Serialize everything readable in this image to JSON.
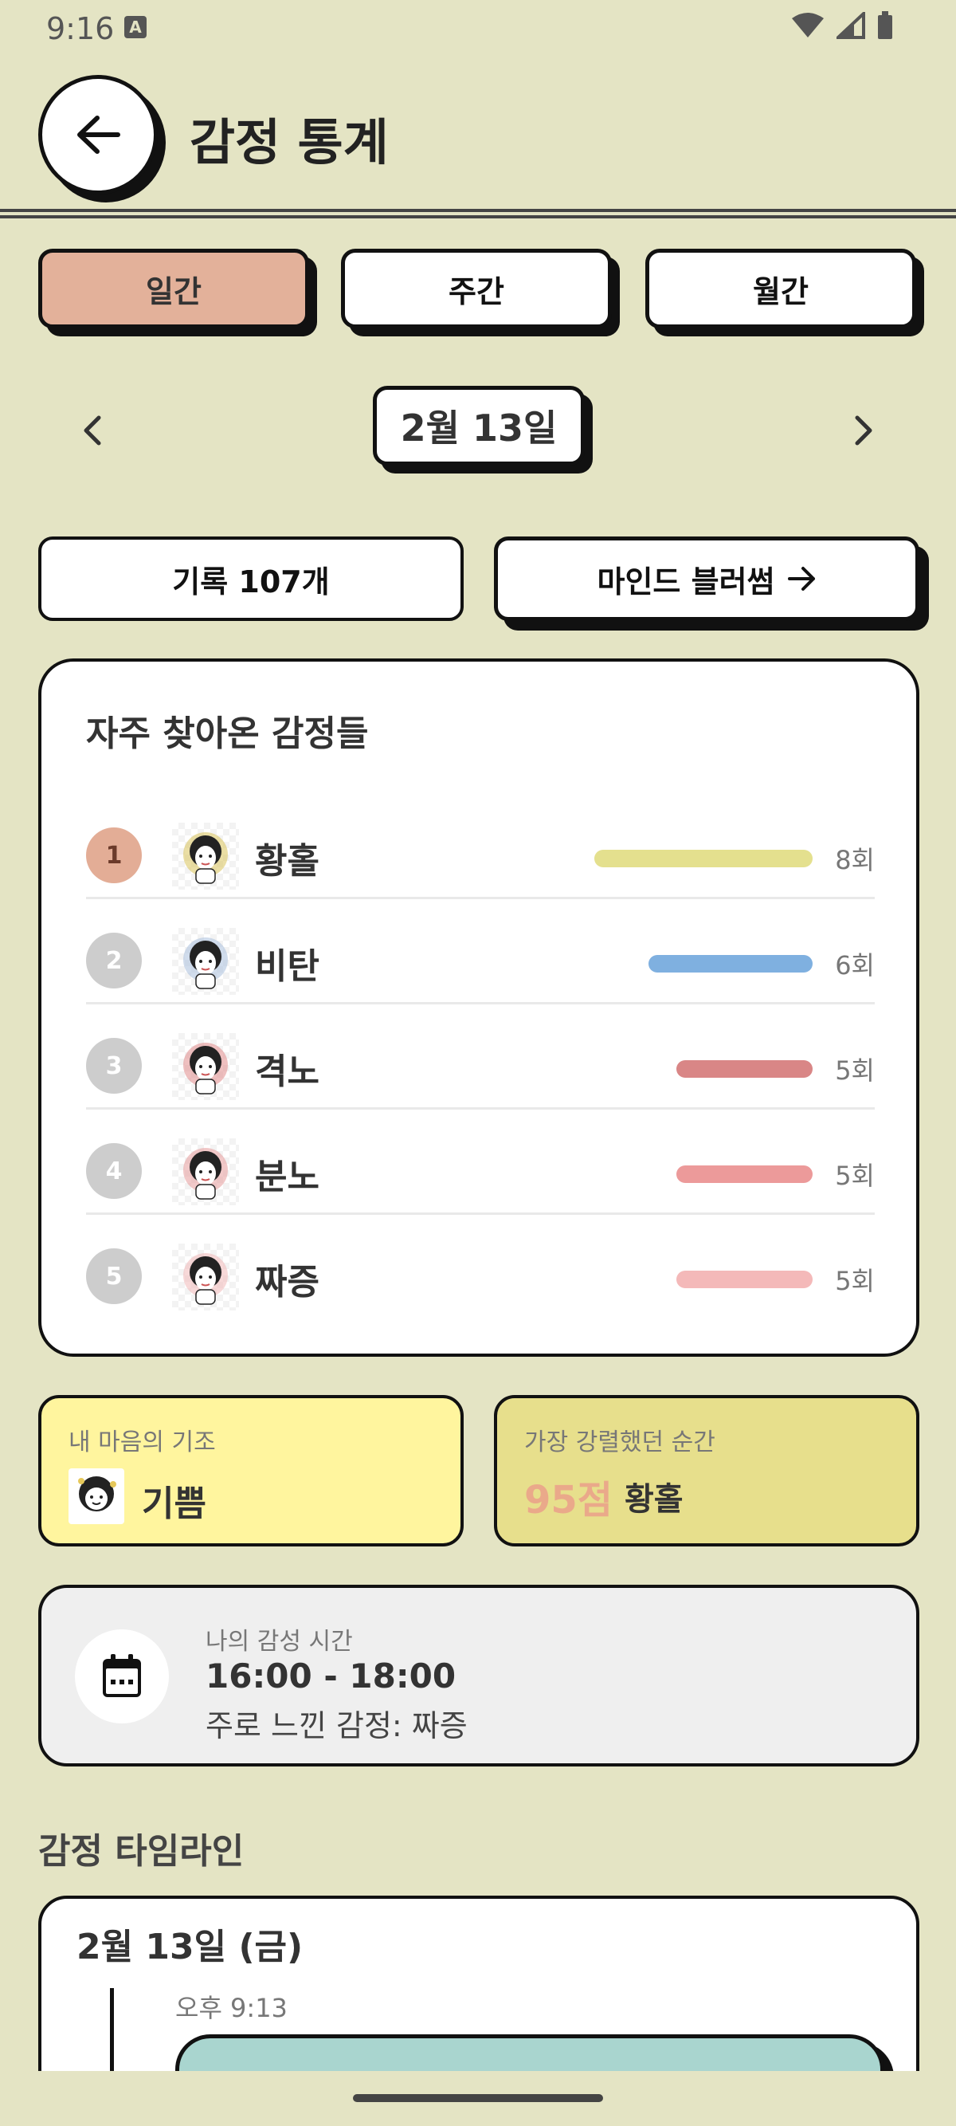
{
  "status_bar": {
    "time": "9:16",
    "notification_icon": "A"
  },
  "header": {
    "back_icon": "arrow-left-icon",
    "title": "감정 통계"
  },
  "period_tabs": [
    {
      "label": "일간",
      "active": true
    },
    {
      "label": "주간",
      "active": false
    },
    {
      "label": "월간",
      "active": false
    }
  ],
  "date_nav": {
    "prev_icon": "chevron-left-icon",
    "date": "2월 13일",
    "next_icon": "chevron-right-icon"
  },
  "actions": {
    "records": "기록 107개",
    "mind_blossom": "마인드 블러썸"
  },
  "frequent_emotions": {
    "title": "자주 찾아온 감정들",
    "items": [
      {
        "rank": "1",
        "name": "황홀",
        "count": "8회",
        "value": 8,
        "color": "#e4e08e"
      },
      {
        "rank": "2",
        "name": "비탄",
        "count": "6회",
        "value": 6,
        "color": "#7fb0e0"
      },
      {
        "rank": "3",
        "name": "격노",
        "count": "5회",
        "value": 5,
        "color": "#d98686"
      },
      {
        "rank": "4",
        "name": "분노",
        "count": "5회",
        "value": 5,
        "color": "#ec9a9a"
      },
      {
        "rank": "5",
        "name": "짜증",
        "count": "5회",
        "value": 5,
        "color": "#f4b9b9"
      }
    ]
  },
  "summary": {
    "base_label": "내 마음의 기조",
    "base_value": "기쁨",
    "peak_label": "가장 강렬했던 순간",
    "peak_score": "95점",
    "peak_emotion": "황홀"
  },
  "sensitive_time": {
    "icon": "calendar-icon",
    "label": "나의 감성 시간",
    "time": "16:00 - 18:00",
    "main_emotion": "주로 느낀 감정: 짜증"
  },
  "timeline": {
    "heading": "감정 타임라인",
    "date": "2월 13일 (금)",
    "entries": [
      {
        "time": "오후 9:13",
        "color": "#a9d5cf"
      }
    ]
  }
}
